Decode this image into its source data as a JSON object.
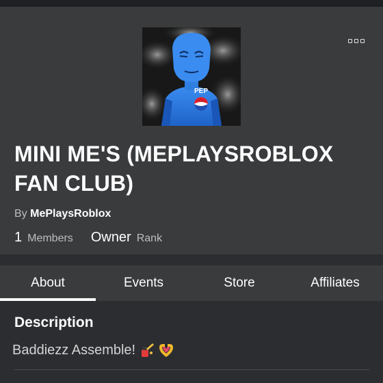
{
  "header": {
    "more_icon": "ellipsis-icon",
    "group_name": "MINI ME'S (MEPLAYSROBLOX FAN CLUB)",
    "by_label": "By",
    "owner": "MePlaysRoblox",
    "members_count": "1",
    "members_label": "Members",
    "rank_value": "Owner",
    "rank_label": "Rank"
  },
  "tabs": [
    {
      "label": "About",
      "active": true
    },
    {
      "label": "Events",
      "active": false
    },
    {
      "label": "Store",
      "active": false
    },
    {
      "label": "Affiliates",
      "active": false
    }
  ],
  "about": {
    "description_heading": "Description",
    "description_text": "Baddiezz Assemble!",
    "emojis": [
      "nail-polish-icon",
      "heart-hands-icon"
    ]
  },
  "colors": {
    "header_bg": "#393b3d",
    "page_bg": "#2b2d31",
    "avatar_blue": "#2f7fe0"
  }
}
